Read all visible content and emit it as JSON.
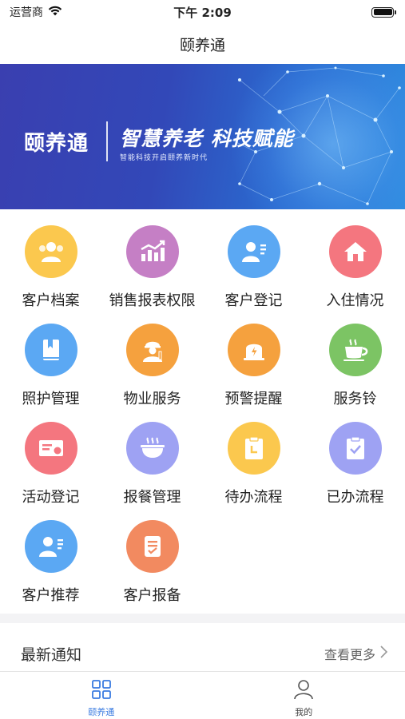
{
  "status_bar": {
    "carrier": "运营商",
    "time": "下午 2:09"
  },
  "nav": {
    "title": "颐养通"
  },
  "banner": {
    "logo_text": "颐养通",
    "headline": "智慧养老 科技赋能",
    "subline": "智能科技开启颐养新时代"
  },
  "grid": {
    "items": [
      {
        "label": "客户档案",
        "icon": "customers-icon",
        "color": "#FBC84E"
      },
      {
        "label": "销售报表权限",
        "icon": "chart-icon",
        "color": "#C57FC5"
      },
      {
        "label": "客户登记",
        "icon": "user-card-icon",
        "color": "#5BA8F3"
      },
      {
        "label": "入住情况",
        "icon": "home-icon",
        "color": "#F4767F"
      },
      {
        "label": "照护管理",
        "icon": "book-icon",
        "color": "#5BA8F3"
      },
      {
        "label": "物业服务",
        "icon": "worker-icon",
        "color": "#F5A13E"
      },
      {
        "label": "预警提醒",
        "icon": "alert-icon",
        "color": "#F5A13E"
      },
      {
        "label": "服务铃",
        "icon": "cup-icon",
        "color": "#7CC464"
      },
      {
        "label": "活动登记",
        "icon": "ticket-icon",
        "color": "#F4767F"
      },
      {
        "label": "报餐管理",
        "icon": "bowl-icon",
        "color": "#9EA2F3"
      },
      {
        "label": "待办流程",
        "icon": "pending-icon",
        "color": "#FBC84E"
      },
      {
        "label": "已办流程",
        "icon": "done-icon",
        "color": "#9EA2F3"
      },
      {
        "label": "客户推荐",
        "icon": "user-card-icon",
        "color": "#5BA8F3"
      },
      {
        "label": "客户报备",
        "icon": "report-icon",
        "color": "#F28A60"
      }
    ]
  },
  "notice": {
    "title": "最新通知",
    "more_label": "查看更多"
  },
  "tabs": [
    {
      "label": "颐养通",
      "icon": "grid-icon",
      "active": true
    },
    {
      "label": "我的",
      "icon": "person-icon",
      "active": false
    }
  ],
  "colors": {
    "accent": "#3A7BE0"
  }
}
